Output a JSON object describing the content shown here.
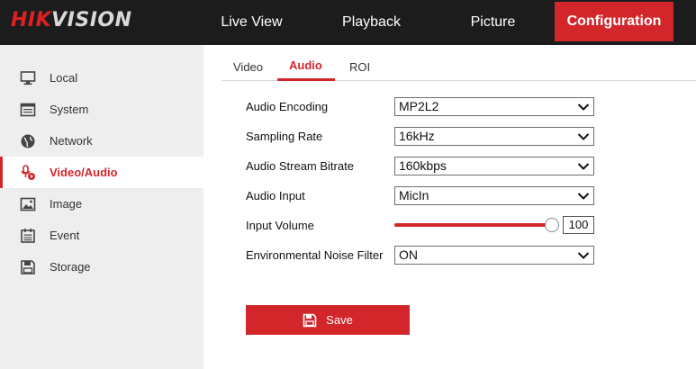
{
  "brand": {
    "name_part1": "HIK",
    "name_part2": "VISION",
    "color": "#d3262b"
  },
  "topnav": [
    {
      "label": "Live View"
    },
    {
      "label": "Playback"
    },
    {
      "label": "Picture"
    },
    {
      "label": "Configuration",
      "active": true
    }
  ],
  "sidebar": {
    "items": [
      {
        "label": "Local",
        "icon": "monitor-icon"
      },
      {
        "label": "System",
        "icon": "window-icon"
      },
      {
        "label": "Network",
        "icon": "globe-icon"
      },
      {
        "label": "Video/Audio",
        "icon": "mic-camera-icon",
        "active": true
      },
      {
        "label": "Image",
        "icon": "image-icon"
      },
      {
        "label": "Event",
        "icon": "calendar-icon"
      },
      {
        "label": "Storage",
        "icon": "disk-icon"
      }
    ]
  },
  "subtabs": [
    {
      "label": "Video"
    },
    {
      "label": "Audio",
      "active": true
    },
    {
      "label": "ROI"
    }
  ],
  "form": {
    "audio_encoding": {
      "label": "Audio Encoding",
      "value": "MP2L2"
    },
    "sampling_rate": {
      "label": "Sampling Rate",
      "value": "16kHz"
    },
    "audio_stream_bitrate": {
      "label": "Audio Stream Bitrate",
      "value": "160kbps"
    },
    "audio_input": {
      "label": "Audio Input",
      "value": "MicIn"
    },
    "input_volume": {
      "label": "Input Volume",
      "value": "100"
    },
    "noise_filter": {
      "label": "Environmental Noise Filter",
      "value": "ON"
    }
  },
  "save_label": "Save"
}
